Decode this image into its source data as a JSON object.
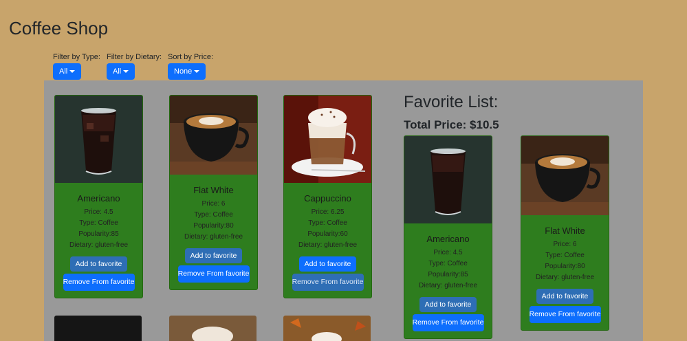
{
  "app": {
    "title": "Coffee Shop"
  },
  "filters": [
    {
      "label": "Filter by Type:",
      "value": "All"
    },
    {
      "label": "Filter by Dietary:",
      "value": "All"
    },
    {
      "label": "Sort by Price:",
      "value": "None"
    }
  ],
  "products": [
    {
      "name": "Americano",
      "price": "Price: 4.5",
      "type": "Type: Coffee",
      "popularity": "Popularity:85",
      "dietary": "Dietary: gluten-free",
      "add_label": "Add to favorite",
      "remove_label": "Remove From favorite",
      "image": "iced-americano"
    },
    {
      "name": "Flat White",
      "price": "Price: 6",
      "type": "Type: Coffee",
      "popularity": "Popularity:80",
      "dietary": "Dietary: gluten-free",
      "add_label": "Add to favorite",
      "remove_label": "Remove From favorite",
      "image": "flat-white-cup"
    },
    {
      "name": "Cappuccino",
      "price": "Price: 6.25",
      "type": "Type: Coffee",
      "popularity": "Popularity:60",
      "dietary": "Dietary: gluten-free",
      "add_label": "Add to favorite",
      "remove_label": "Remove From favorite",
      "image": "cappuccino-glass"
    }
  ],
  "favorites": {
    "title": "Favorite List:",
    "total": "Total Price: $10.5",
    "items": [
      {
        "name": "Americano",
        "price": "Price: 4.5",
        "type": "Type: Coffee",
        "popularity": "Popularity:85",
        "dietary": "Dietary: gluten-free",
        "add_label": "Add to favorite",
        "remove_label": "Remove From favorite"
      },
      {
        "name": "Flat White",
        "price": "Price: 6",
        "type": "Type: Coffee",
        "popularity": "Popularity:80",
        "dietary": "Dietary: gluten-free",
        "add_label": "Add to favorite",
        "remove_label": "Remove From favorite"
      }
    ]
  },
  "colors": {
    "page_bg": "#c8a46b",
    "panel_bg": "#999999",
    "card_bg": "#2e7d1e",
    "primary": "#0d6efd"
  }
}
